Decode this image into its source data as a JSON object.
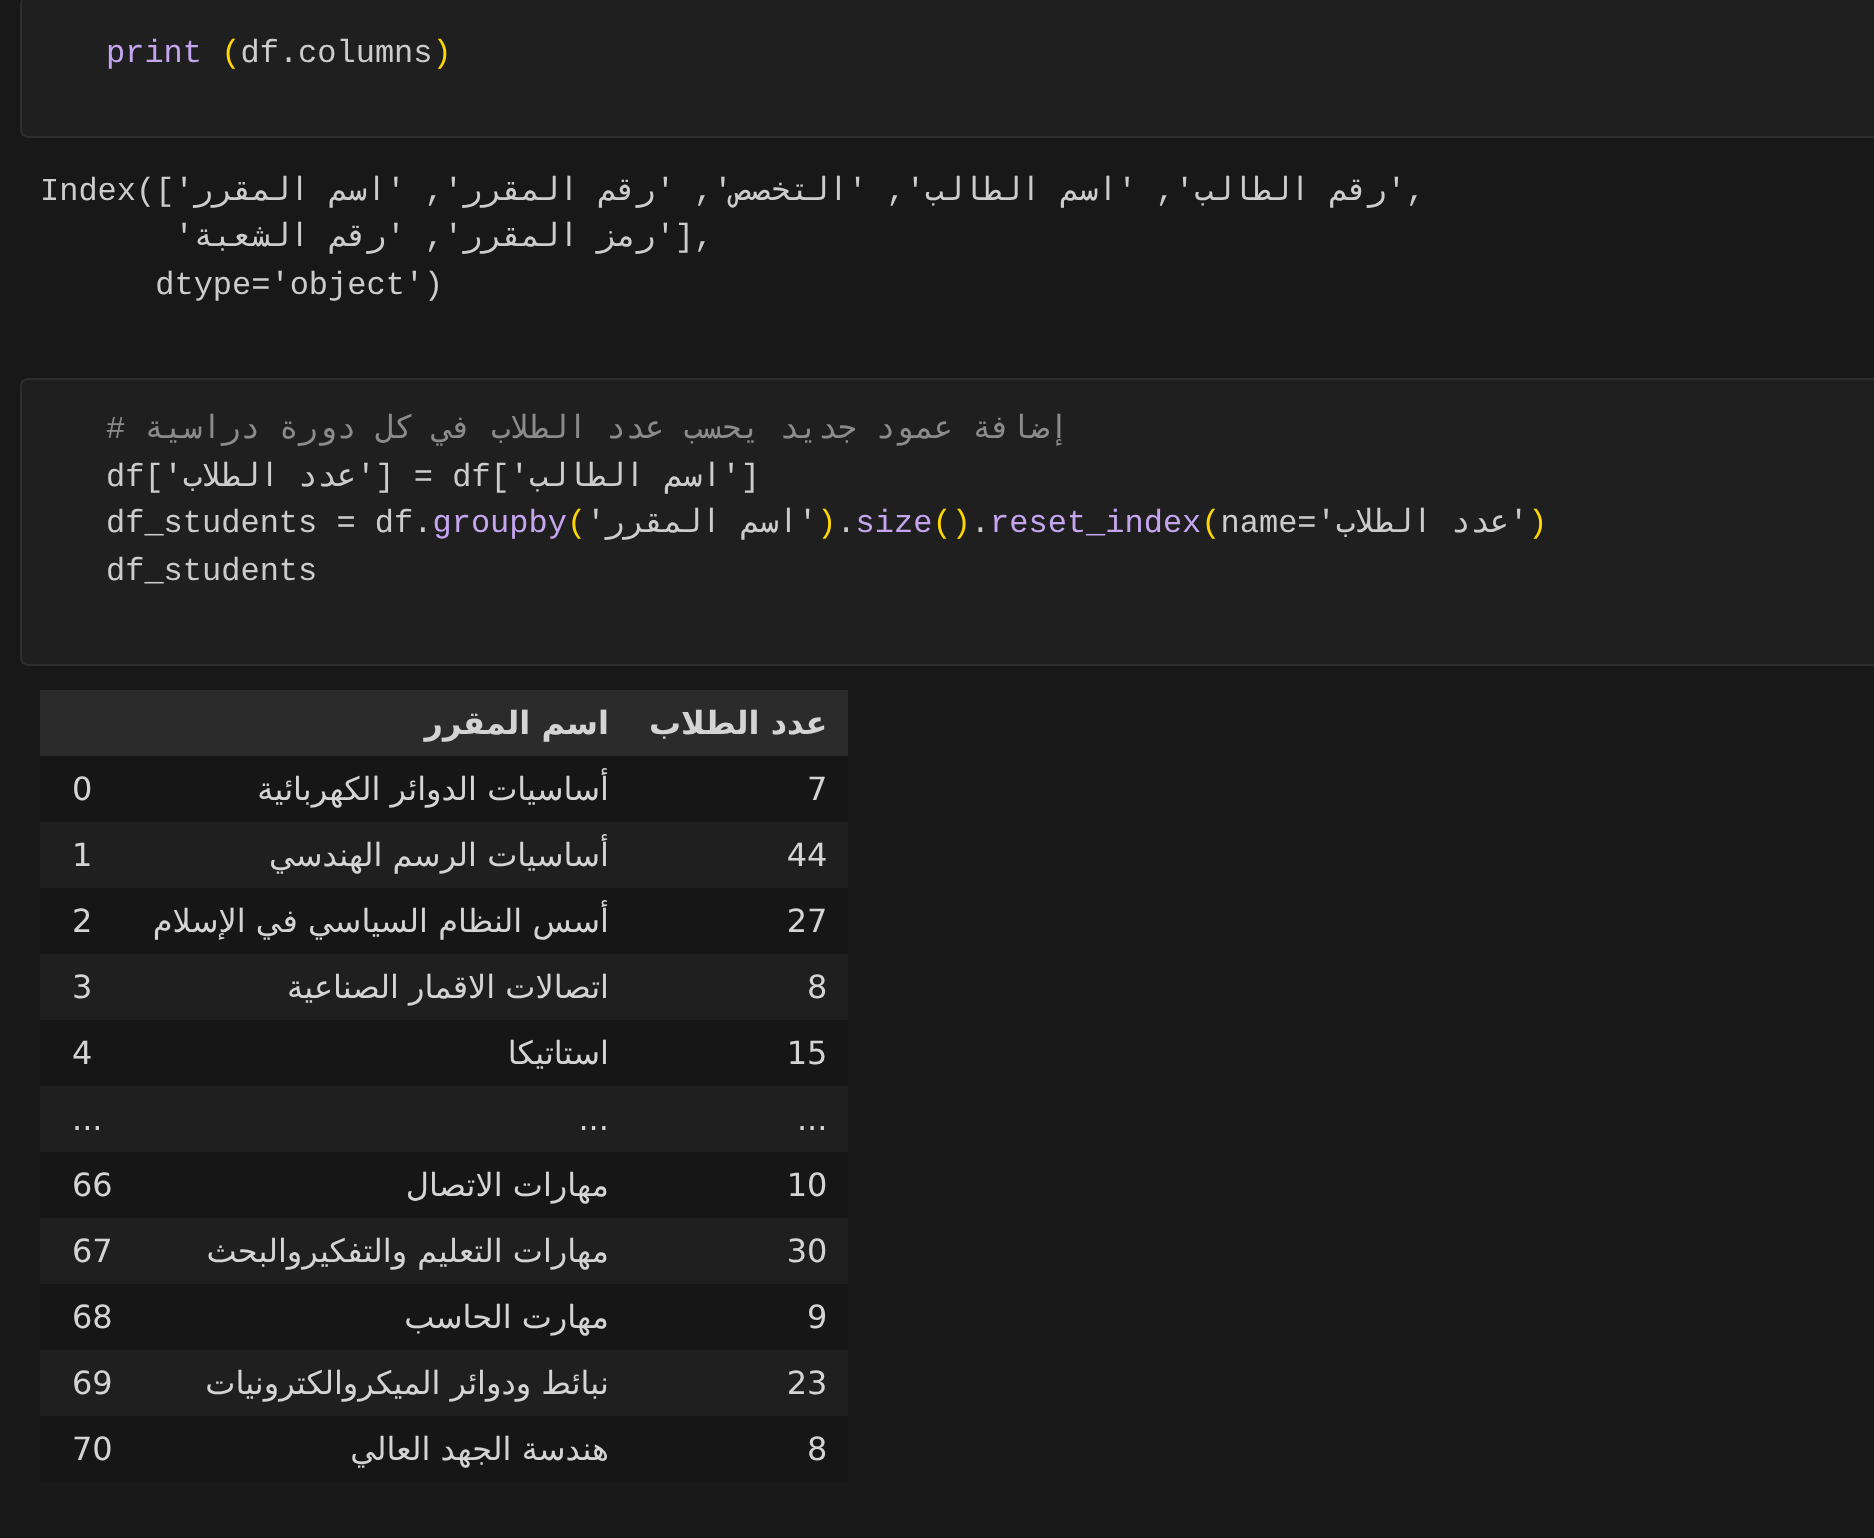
{
  "cells": [
    {
      "kind": "code",
      "lines": [
        "print (df.columns)"
      ]
    },
    {
      "kind": "output",
      "lines": [
        "Index(['رقم الطالب', 'اسم الطالب', 'التخصص', 'رقم المقرر', 'اسم المقرر',",
        "       'رمز المقرر', 'رقم الشعبة'],",
        "      dtype='object')"
      ]
    },
    {
      "kind": "code",
      "lines": [
        "# إضافة عمود جديد يحسب عدد الطلاب في كل دورة دراسية",
        "df['عدد الطلاب'] = df['اسم الطالب']",
        "df_students = df.groupby('اسم المقرر').size().reset_index(name='عدد الطلاب')",
        "df_students"
      ]
    },
    {
      "kind": "table",
      "columns": [
        "عدد الطلاب",
        "اسم المقرر"
      ],
      "rows": [
        [
          "7",
          "أساسيات الدوائر الكهربائية",
          "0"
        ],
        [
          "44",
          "أساسيات الرسم الهندسي",
          "1"
        ],
        [
          "27",
          "أسس النظام السياسي في الإسلام",
          "2"
        ],
        [
          "8",
          "اتصالات الاقمار الصناعية",
          "3"
        ],
        [
          "15",
          "استاتيكا",
          "4"
        ],
        [
          "...",
          "...",
          "..."
        ],
        [
          "10",
          "مهارات الاتصال",
          "66"
        ],
        [
          "30",
          "مهارات التعليم والتفكيروالبحث",
          "67"
        ],
        [
          "9",
          "مهارت الحاسب",
          "68"
        ],
        [
          "23",
          "نبائط ودوائر الميكروالكترونيات",
          "69"
        ],
        [
          "8",
          "هندسة الجهد العالي",
          "70"
        ]
      ]
    }
  ]
}
